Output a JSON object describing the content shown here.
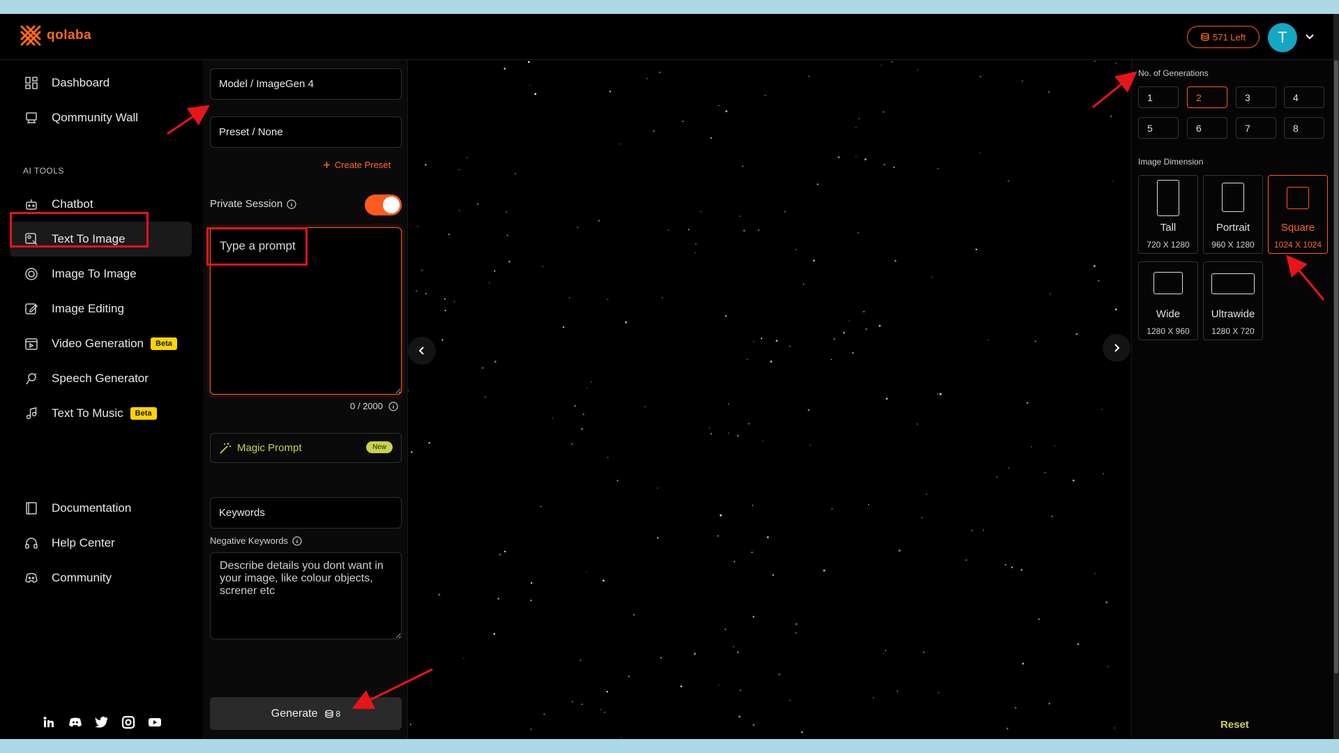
{
  "header": {
    "logo_text": "qolaba",
    "credits": "571 Left",
    "avatar_letter": "T"
  },
  "sidebar": {
    "items_top": [
      {
        "label": "Dashboard",
        "icon": "dashboard-icon"
      },
      {
        "label": "Qommunity Wall",
        "icon": "community-wall-icon"
      }
    ],
    "section_label": "AI TOOLS",
    "tools": [
      {
        "label": "Chatbot",
        "icon": "robot-icon"
      },
      {
        "label": "Text To Image",
        "icon": "text-image-icon",
        "active": true
      },
      {
        "label": "Image To Image",
        "icon": "image-to-image-icon"
      },
      {
        "label": "Image Editing",
        "icon": "edit-icon"
      },
      {
        "label": "Video Generation",
        "icon": "video-icon",
        "badge": "Beta"
      },
      {
        "label": "Speech Generator",
        "icon": "speech-icon"
      },
      {
        "label": "Text To Music",
        "icon": "music-icon",
        "badge": "Beta"
      }
    ],
    "items_bottom": [
      {
        "label": "Documentation",
        "icon": "book-icon"
      },
      {
        "label": "Help Center",
        "icon": "headset-icon"
      },
      {
        "label": "Community",
        "icon": "discord-icon"
      }
    ]
  },
  "panel": {
    "model": "Model / ImageGen 4",
    "preset": "Preset / None",
    "create_preset": "Create Preset",
    "private_session": "Private Session",
    "prompt_placeholder": "Type a prompt",
    "prompt_counter": "0 / 2000",
    "magic_prompt": "Magic Prompt",
    "magic_badge": "New",
    "keywords": "Keywords",
    "negative_label": "Negative Keywords",
    "negative_placeholder": "Describe details you dont want in your image, like colour objects, screner etc",
    "generate_label": "Generate",
    "generate_cost": "8"
  },
  "right": {
    "generations_label": "No. of Generations",
    "generations": [
      "1",
      "2",
      "3",
      "4",
      "5",
      "6",
      "7",
      "8"
    ],
    "generations_selected": "2",
    "dimension_label": "Image Dimension",
    "dimensions": [
      {
        "name": "Tall",
        "size": "720 X 1280"
      },
      {
        "name": "Portrait",
        "size": "960 X 1280"
      },
      {
        "name": "Square",
        "size": "1024 X 1024",
        "selected": true
      },
      {
        "name": "Wide",
        "size": "1280 X 960"
      },
      {
        "name": "Ultrawide",
        "size": "1280 X 720"
      }
    ],
    "reset": "Reset"
  },
  "colors": {
    "accent": "#ff5a1f",
    "lime": "#c8d24a",
    "beta": "#ffd400",
    "avatar": "#14a7c4",
    "annotation": "#e8141b"
  }
}
